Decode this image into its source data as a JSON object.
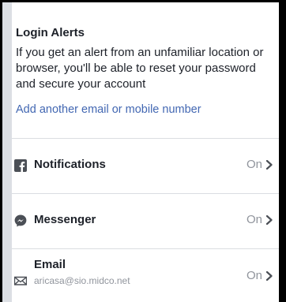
{
  "login_alerts": {
    "title": "Login Alerts",
    "description": "If you get an alert from an unfamiliar location or browser, you'll be able to reset your password and secure your account",
    "add_link": "Add another email or mobile number"
  },
  "channels": [
    {
      "label": "Notifications",
      "value": "On",
      "icon": "facebook-icon"
    },
    {
      "label": "Messenger",
      "value": "On",
      "icon": "messenger-icon"
    },
    {
      "label": "Email",
      "sublabel": "aricasa@sio.midco.net",
      "value": "On",
      "icon": "envelope-icon"
    }
  ],
  "colors": {
    "link": "#4267b2",
    "text": "#1d2129",
    "muted": "#90949c",
    "icon": "#4b4f56"
  }
}
